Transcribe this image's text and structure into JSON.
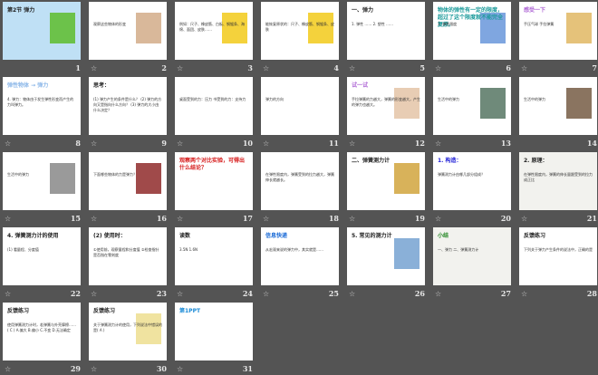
{
  "view": "slide-sorter",
  "star_icon": "star-outline-icon",
  "slides": [
    {
      "number": "1",
      "title": "第2节 弹力",
      "body": "",
      "bg": "#bfe0f5",
      "color": "#222",
      "star": false,
      "pic": "#6cc24a"
    },
    {
      "number": "2",
      "title": "",
      "body": "观察这些物体的形变",
      "bg": "#ffffff",
      "color": "#1a4fd6",
      "star": true,
      "pic": "#d9b89a"
    },
    {
      "number": "3",
      "title": "",
      "body": "例如：尺子、橡皮筋、白板、钢锯条、海绵、面团、皮肤……",
      "bg": "#ffffff",
      "color": "#1a1ad6",
      "star": true,
      "pic": "#f4d23c"
    },
    {
      "number": "4",
      "title": "",
      "body": "能恢复原状的：尺子、橡皮筋、钢锯条、皮肤",
      "bg": "#ffffff",
      "color": "#1a1ad6",
      "star": true,
      "pic": "#f4d23c"
    },
    {
      "number": "5",
      "title": "一、弹力",
      "body": "1. 弹性 …… 2. 塑性 ……",
      "bg": "#ffffff",
      "color": "#222",
      "star": true,
      "pic": ""
    },
    {
      "number": "6",
      "title": "物体的弹性有一定的限度，超过了这个限度就不能完全复原。",
      "body": "3. 弹性限度",
      "bg": "#ffffff",
      "color": "#1a9a9a",
      "star": true,
      "pic": "#7fa6e0"
    },
    {
      "number": "7",
      "title": "感受一下",
      "body": "手压气球  手拉弹簧",
      "bg": "#ffffff",
      "color": "#b06ad6",
      "star": true,
      "pic": "#e5c27a"
    },
    {
      "number": "8",
      "title": "弹性物体 → 弹力",
      "body": "4. 弹力：物体由于发生弹性形变而产生的力叫弹力。",
      "bg": "#ffffff",
      "color": "#8ab6e8",
      "star": true,
      "pic": ""
    },
    {
      "number": "9",
      "title": "思考：",
      "body": "(1) 弹力产生的条件是什么？ (2) 弹力的方向又是指向什么方向？ (3) 弹力的大小由什么决定？",
      "bg": "#ffffff",
      "color": "#222",
      "star": true,
      "pic": ""
    },
    {
      "number": "10",
      "title": "",
      "body": "桌面受到的力：压力 书受到的力：支持力",
      "bg": "#ffffff",
      "color": "#222",
      "star": true,
      "pic": ""
    },
    {
      "number": "11",
      "title": "",
      "body": "弹力的方向",
      "bg": "#ffffff",
      "color": "#1a1ad6",
      "star": true,
      "pic": ""
    },
    {
      "number": "12",
      "title": "试一试",
      "body": "手拉弹簧的力越大，弹簧的形变越大，产生的弹力也越大。",
      "bg": "#ffffff",
      "color": "#b06ad6",
      "star": true,
      "pic": "#e8cdb4"
    },
    {
      "number": "13",
      "title": "",
      "body": "生活中的弹力",
      "bg": "#ffffff",
      "color": "#222",
      "star": true,
      "pic": "#6f8a7a"
    },
    {
      "number": "14",
      "title": "",
      "body": "生活中的弹力",
      "bg": "#ffffff",
      "color": "#222",
      "star": false,
      "pic": "#8a7460"
    },
    {
      "number": "15",
      "title": "",
      "body": "生活中的弹力",
      "bg": "#ffffff",
      "color": "#222",
      "star": true,
      "pic": "#9a9a9a"
    },
    {
      "number": "16",
      "title": "",
      "body": "下面哪些物体的力是弹力？",
      "bg": "#ffffff",
      "color": "#d61a1a",
      "star": true,
      "pic": "#a04a4a"
    },
    {
      "number": "17",
      "title": "观察两个对比实验，可得出什么结论？",
      "body": "",
      "bg": "#ffffff",
      "color": "#d61a1a",
      "star": true,
      "pic": ""
    },
    {
      "number": "18",
      "title": "",
      "body": "在弹性限度内，弹簧受到的拉力越大，弹簧伸长就越长。",
      "bg": "#ffffff",
      "color": "#1a1ad6",
      "star": true,
      "pic": ""
    },
    {
      "number": "19",
      "title": "二、弹簧测力计",
      "body": "",
      "bg": "#ffffff",
      "color": "#222",
      "star": true,
      "pic": "#d8b25a"
    },
    {
      "number": "20",
      "title": "1. 构造：",
      "body": "弹簧测力计由哪几部分组成？",
      "bg": "#ffffff",
      "color": "#1a1ad6",
      "star": true,
      "pic": ""
    },
    {
      "number": "21",
      "title": "2. 原理：",
      "body": "在弹性限度内，弹簧的伸长量跟受到的拉力成正比",
      "bg": "#f2f2ee",
      "color": "#222",
      "star": true,
      "pic": ""
    },
    {
      "number": "22",
      "title": "4. 弹簧测力计的使用",
      "body": "(1) 看量程、分度值",
      "bg": "#ffffff",
      "color": "#222",
      "star": true,
      "pic": ""
    },
    {
      "number": "23",
      "title": "(2) 使用时：",
      "body": "①使用前，观察量程和分度值 ②检查指针是否指在零刻度",
      "bg": "#ffffff",
      "color": "#222",
      "star": true,
      "pic": ""
    },
    {
      "number": "24",
      "title": "读数",
      "body": "3.5N  1.6N",
      "bg": "#ffffff",
      "color": "#222",
      "star": true,
      "pic": ""
    },
    {
      "number": "25",
      "title": "信息快递",
      "body": "从宏观来说的弹力中，其实就是……",
      "bg": "#ffffff",
      "color": "#1a6ad6",
      "star": true,
      "pic": ""
    },
    {
      "number": "26",
      "title": "5. 常见的测力计",
      "body": "",
      "bg": "#ffffff",
      "color": "#222",
      "star": true,
      "pic": "#8ab0d8"
    },
    {
      "number": "27",
      "title": "小结",
      "body": "一、弹力 二、弹簧测力计",
      "bg": "#f2f2ee",
      "color": "#2a8a2a",
      "star": true,
      "pic": ""
    },
    {
      "number": "28",
      "title": "反馈练习",
      "body": "下列关于弹力产生条件的说法中，正确的是",
      "bg": "#ffffff",
      "color": "#222",
      "star": true,
      "pic": ""
    },
    {
      "number": "29",
      "title": "反馈练习",
      "body": "使用弹簧测力计时，若弹簧与外壳摩擦……( C ) A.偏大 B.偏小 C.不变 D.无法确定",
      "bg": "#ffffff",
      "color": "#222",
      "star": true,
      "pic": ""
    },
    {
      "number": "30",
      "title": "反馈练习",
      "body": "关于弹簧测力计的使用，下列说法中错误的是( A )",
      "bg": "#ffffff",
      "color": "#222",
      "star": true,
      "pic": "#f0e3a0"
    },
    {
      "number": "31",
      "title": "第1PPT",
      "body": "",
      "bg": "#ffffff",
      "color": "#1a8ad6",
      "star": true,
      "pic": ""
    }
  ]
}
